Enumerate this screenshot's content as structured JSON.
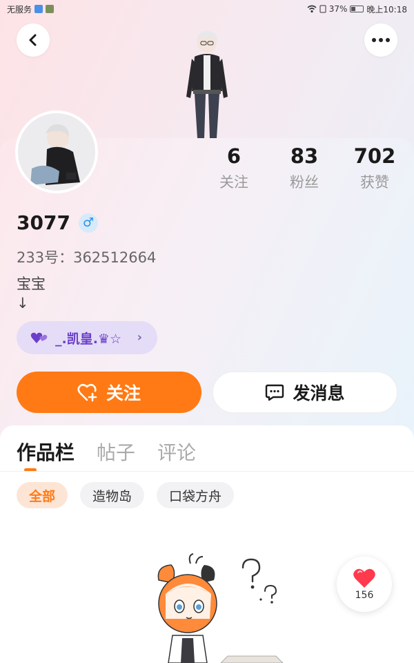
{
  "status_bar": {
    "carrier": "无服务",
    "battery": "37%",
    "time": "晚上10:18"
  },
  "profile": {
    "username": "3077",
    "gender_symbol": "♂",
    "uid": "233号：362512664",
    "bio": "宝宝\n↓",
    "fan_tag": "_.凯皇.♛☆",
    "stats": [
      {
        "num": "6",
        "label": "关注"
      },
      {
        "num": "83",
        "label": "粉丝"
      },
      {
        "num": "702",
        "label": "获赞"
      }
    ]
  },
  "actions": {
    "follow": "关注",
    "message": "发消息"
  },
  "tabs": [
    "作品栏",
    "帖子",
    "评论"
  ],
  "filters": [
    "全部",
    "造物岛",
    "口袋方舟"
  ],
  "like_count": "156",
  "colors": {
    "accent": "#ff7a14",
    "fan_tag_bg": "#e5ddf7",
    "fan_tag_text": "#6b3fc9"
  },
  "icons": {
    "back": "chevron-left-icon",
    "more": "more-dots-icon",
    "follow": "heart-plus-icon",
    "message": "chat-bubble-icon",
    "like": "heart-icon"
  }
}
